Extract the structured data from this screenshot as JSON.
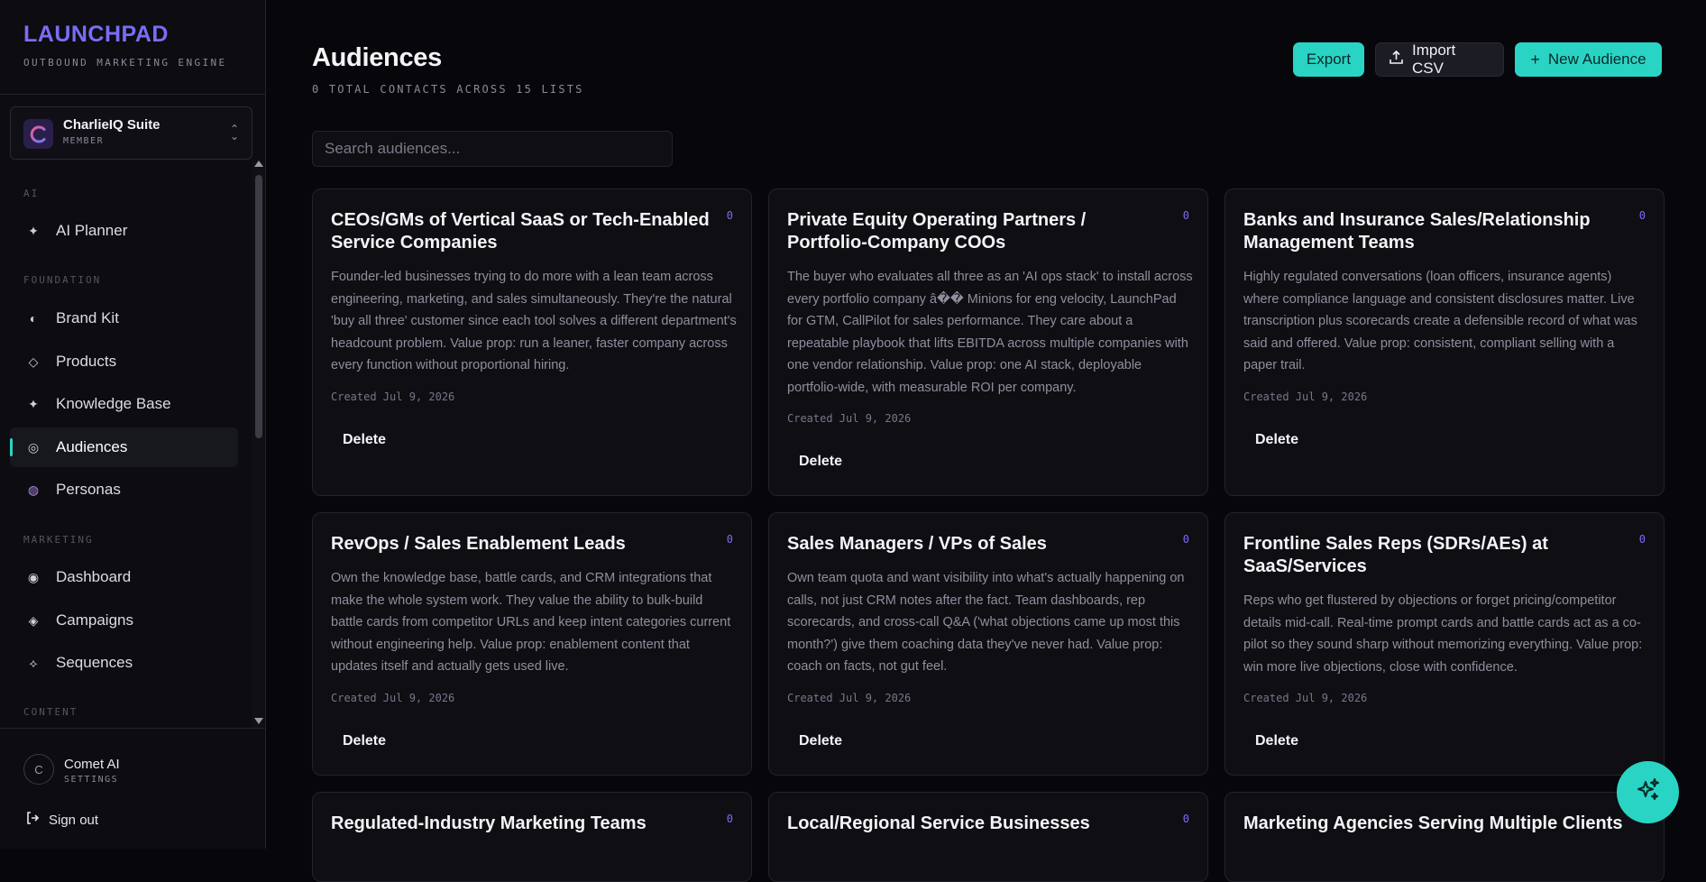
{
  "brand": {
    "name": "LAUNCHPAD",
    "tagline": "OUTBOUND MARKETING ENGINE"
  },
  "org": {
    "name": "CharlieIQ Suite",
    "role": "MEMBER"
  },
  "nav": {
    "sections": {
      "ai": "AI",
      "foundation": "FOUNDATION",
      "marketing": "MARKETING",
      "content": "CONTENT"
    },
    "items": [
      {
        "label": "AI Planner",
        "icon": "sparkle-icon"
      },
      {
        "label": "Brand Kit",
        "icon": "half-circle-icon"
      },
      {
        "label": "Products",
        "icon": "diamond-outline-icon"
      },
      {
        "label": "Knowledge Base",
        "icon": "sparkle-icon"
      },
      {
        "label": "Audiences",
        "icon": "target-icon",
        "active": true
      },
      {
        "label": "Personas",
        "icon": "persona-icon"
      },
      {
        "label": "Dashboard",
        "icon": "dot-circle-icon"
      },
      {
        "label": "Campaigns",
        "icon": "diamond-filled-icon"
      },
      {
        "label": "Sequences",
        "icon": "diamond-small-icon"
      }
    ]
  },
  "user": {
    "initial": "C",
    "name": "Comet AI",
    "sub": "SETTINGS"
  },
  "signout": "Sign out",
  "header": {
    "title": "Audiences",
    "subtitle": "0 TOTAL CONTACTS ACROSS 15 LISTS",
    "export_label": "Export",
    "import_label": "Import CSV",
    "new_label": "New Audience"
  },
  "search": {
    "placeholder": "Search audiences..."
  },
  "cards": [
    {
      "title": "CEOs/GMs of Vertical SaaS or Tech-Enabled Service Companies",
      "count": "0",
      "desc": "Founder-led businesses trying to do more with a lean team across engineering, marketing, and sales simultaneously. They're the natural 'buy all three' customer since each tool solves a different department's headcount problem. Value prop: run a leaner, faster company across every function without proportional hiring.",
      "date": "Created Jul 9, 2026",
      "delete": "Delete"
    },
    {
      "title": "Private Equity Operating Partners / Portfolio-Company COOs",
      "count": "0",
      "desc": "The buyer who evaluates all three as an 'AI ops stack' to install across every portfolio company â�� Minions for eng velocity, LaunchPad for GTM, CallPilot for sales performance. They care about a repeatable playbook that lifts EBITDA across multiple companies with one vendor relationship. Value prop: one AI stack, deployable portfolio-wide, with measurable ROI per company.",
      "date": "Created Jul 9, 2026",
      "delete": "Delete"
    },
    {
      "title": "Banks and Insurance Sales/Relationship Management Teams",
      "count": "0",
      "desc": "Highly regulated conversations (loan officers, insurance agents) where compliance language and consistent disclosures matter. Live transcription plus scorecards create a defensible record of what was said and offered. Value prop: consistent, compliant selling with a paper trail.",
      "date": "Created Jul 9, 2026",
      "delete": "Delete"
    },
    {
      "title": "RevOps / Sales Enablement Leads",
      "count": "0",
      "desc": "Own the knowledge base, battle cards, and CRM integrations that make the whole system work. They value the ability to bulk-build battle cards from competitor URLs and keep intent categories current without engineering help. Value prop: enablement content that updates itself and actually gets used live.",
      "date": "Created Jul 9, 2026",
      "delete": "Delete"
    },
    {
      "title": "Sales Managers / VPs of Sales",
      "count": "0",
      "desc": "Own team quota and want visibility into what's actually happening on calls, not just CRM notes after the fact. Team dashboards, rep scorecards, and cross-call Q&A ('what objections came up most this month?') give them coaching data they've never had. Value prop: coach on facts, not gut feel.",
      "date": "Created Jul 9, 2026",
      "delete": "Delete"
    },
    {
      "title": "Frontline Sales Reps (SDRs/AEs) at SaaS/Services",
      "count": "0",
      "desc": "Reps who get flustered by objections or forget pricing/competitor details mid-call. Real-time prompt cards and battle cards act as a co-pilot so they sound sharp without memorizing everything. Value prop: win more live objections, close with confidence.",
      "date": "Created Jul 9, 2026",
      "delete": "Delete"
    },
    {
      "title": "Regulated-Industry Marketing Teams",
      "count": "0"
    },
    {
      "title": "Local/Regional Service Businesses",
      "count": "0"
    },
    {
      "title": "Marketing Agencies Serving Multiple Clients",
      "count": ""
    }
  ],
  "colors": {
    "accent": "#2ad4c4",
    "brand": "#7b6cf6",
    "background": "#07070b"
  }
}
